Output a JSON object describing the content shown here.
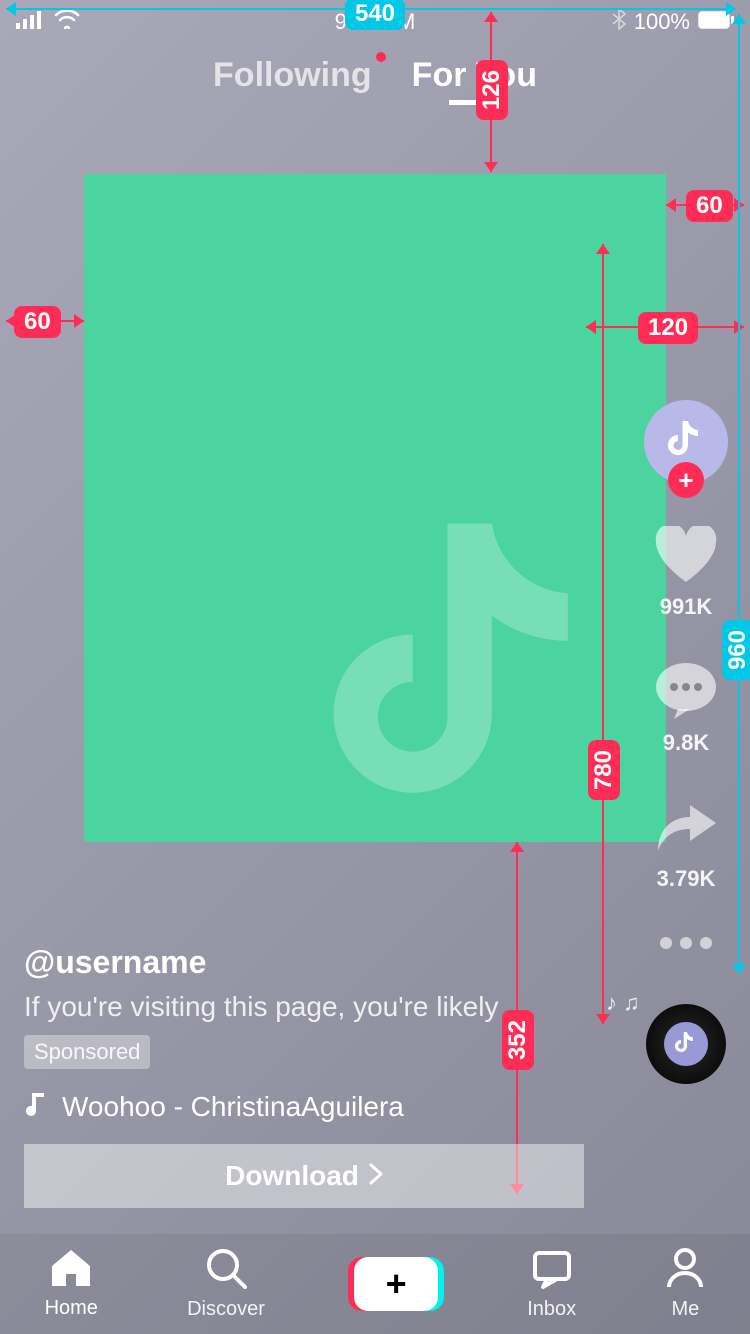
{
  "status": {
    "time": "9:41 AM",
    "battery": "100%"
  },
  "tabs": {
    "following": "Following",
    "for_you": "For You"
  },
  "rail": {
    "likes": "991K",
    "comments": "9.8K",
    "shares": "3.79K"
  },
  "caption": {
    "username": "@username",
    "text": "If you're visiting this page, you're likely",
    "sponsored": "Sponsored",
    "sound": "Woohoo - ChristinaAguilera"
  },
  "cta": {
    "label": "Download"
  },
  "nav": {
    "home": "Home",
    "discover": "Discover",
    "inbox": "Inbox",
    "me": "Me"
  },
  "annotations": {
    "top_width": "540",
    "top_gap": "126",
    "left_margin": "60",
    "right_top_margin": "60",
    "right_rail_width": "120",
    "rail_height": "780",
    "right_height": "960",
    "bottom_gap": "352"
  }
}
